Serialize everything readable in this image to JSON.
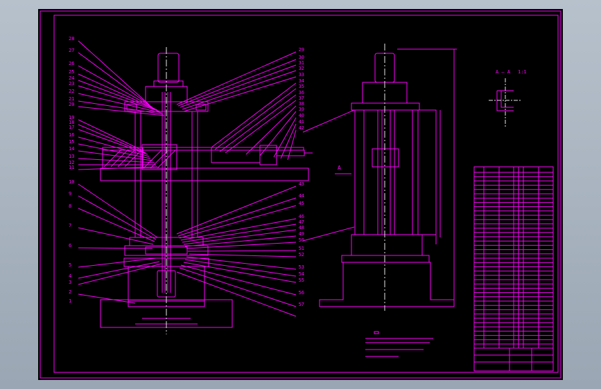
{
  "drawing": {
    "colors": {
      "background": "#000000",
      "outline": "#ff00ff",
      "centerline": "#e8e8e8",
      "viewer_background": "#a9b3be"
    },
    "leader_labels_left": [
      "28",
      "27",
      "26",
      "25",
      "24",
      "23",
      "22",
      "21",
      "20",
      "19",
      "18",
      "17",
      "16",
      "15",
      "14",
      "13",
      "12",
      "11",
      "10",
      "9",
      "8",
      "7",
      "6",
      "5",
      "4",
      "3",
      "2",
      "1"
    ],
    "leader_labels_right": [
      "29",
      "30",
      "31",
      "32",
      "33",
      "34",
      "35",
      "36",
      "37",
      "38",
      "39",
      "40",
      "41",
      "42",
      "43",
      "44",
      "45",
      "46",
      "47",
      "48",
      "49",
      "50",
      "51",
      "52",
      "53",
      "54",
      "55",
      "56",
      "57"
    ],
    "section_marker": "A",
    "section_view_title": "A — A",
    "section_view_scale": "1:1"
  }
}
